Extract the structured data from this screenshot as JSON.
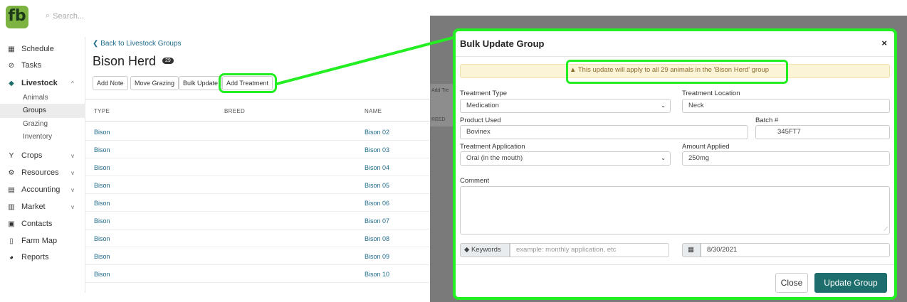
{
  "topbar": {
    "logo": "fb",
    "search_placeholder": "Search..."
  },
  "sidebar": {
    "items": [
      {
        "label": "Schedule",
        "icon": "calendar-icon",
        "glyph": "▦"
      },
      {
        "label": "Tasks",
        "icon": "check-circle-icon",
        "glyph": "⊘"
      },
      {
        "label": "Livestock",
        "icon": "livestock-icon",
        "glyph": "◆",
        "chevron": "^"
      },
      {
        "label": "Crops",
        "icon": "sprout-icon",
        "glyph": "Y",
        "chevron": "v"
      },
      {
        "label": "Resources",
        "icon": "tractor-icon",
        "glyph": "⚙",
        "chevron": "v"
      },
      {
        "label": "Accounting",
        "icon": "calculator-icon",
        "glyph": "▤",
        "chevron": "v"
      },
      {
        "label": "Market",
        "icon": "store-icon",
        "glyph": "▥",
        "chevron": "v"
      },
      {
        "label": "Contacts",
        "icon": "contact-card-icon",
        "glyph": "▣"
      },
      {
        "label": "Farm Map",
        "icon": "map-icon",
        "glyph": "▯"
      },
      {
        "label": "Reports",
        "icon": "pie-chart-icon",
        "glyph": "◕"
      }
    ],
    "livestock_sub": [
      "Animals",
      "Groups",
      "Grazing",
      "Inventory"
    ]
  },
  "main": {
    "back_link": "❮ Back to Livestock Groups",
    "title": "Bison Herd",
    "count": "29",
    "buttons": [
      "Add Note",
      "Move Grazing",
      "Bulk Update",
      "Add Treatment"
    ],
    "columns": [
      "TYPE",
      "BREED",
      "NAME"
    ],
    "rows": [
      {
        "type": "Bison",
        "name": "Bison 02"
      },
      {
        "type": "Bison",
        "name": "Bison 03"
      },
      {
        "type": "Bison",
        "name": "Bison 04"
      },
      {
        "type": "Bison",
        "name": "Bison 05"
      },
      {
        "type": "Bison",
        "name": "Bison 06"
      },
      {
        "type": "Bison",
        "name": "Bison 07"
      },
      {
        "type": "Bison",
        "name": "Bison 08"
      },
      {
        "type": "Bison",
        "name": "Bison 09"
      },
      {
        "type": "Bison",
        "name": "Bison 10"
      }
    ]
  },
  "background_strip": {
    "btn": "Add Tre",
    "col": "REED"
  },
  "modal": {
    "title": "Bulk Update Group",
    "close": "×",
    "warning": "▲ This update will apply to all 29 animals in the 'Bison Herd' group",
    "treatment_type_label": "Treatment Type",
    "treatment_type_value": "Medication",
    "treatment_location_label": "Treatment Location",
    "treatment_location_value": "Neck",
    "product_used_label": "Product Used",
    "product_used_value": "Bovinex",
    "batch_label": "Batch #",
    "batch_value": "345FT7",
    "treatment_application_label": "Treatment Application",
    "treatment_application_value": "Oral (in the mouth)",
    "amount_applied_label": "Amount Applied",
    "amount_applied_value": "250mg",
    "comment_label": "Comment",
    "keywords_label": "Keywords",
    "keywords_placeholder": "example: monthly application, etc",
    "date_value": "8/30/2021",
    "close_button": "Close",
    "update_button": "Update Group"
  },
  "colors": {
    "highlight": "#22ee22",
    "primary": "#1f6e6e",
    "brand": "#7cb342",
    "link": "#1e6b8a"
  }
}
